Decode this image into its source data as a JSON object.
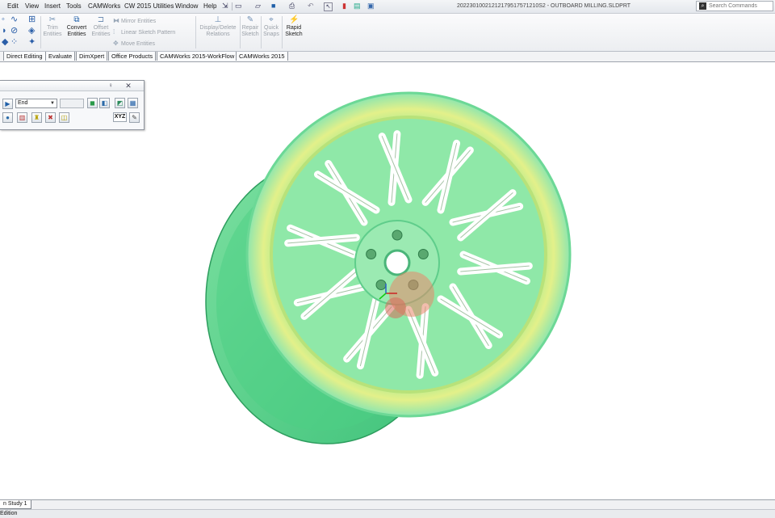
{
  "menu": {
    "items": [
      "Edit",
      "View",
      "Insert",
      "Tools",
      "CAMWorks",
      "CW 2015 Utilities",
      "Window",
      "Help"
    ]
  },
  "document": {
    "title": "20223010021212179517571210S2 - OUTBOARD MILLING.SLDPRT"
  },
  "search": {
    "placeholder": "Search Commands"
  },
  "ribbon": {
    "trim": "Trim Entities",
    "convert": "Convert Entities",
    "offset": "Offset Entities",
    "mirror": "Mirror Entities",
    "linear_pattern": "Linear Sketch Pattern",
    "move": "Move Entities",
    "relations": "Display/Delete Relations",
    "repair": "Repair Sketch",
    "quick_snaps": "Quick Snaps",
    "rapid_sketch": "Rapid Sketch"
  },
  "tabs": [
    "Direct Editing",
    "Evaluate",
    "DimXpert",
    "Office Products",
    "CAMWorks 2015-WorkFlow",
    "CAMWorks 2015"
  ],
  "panel": {
    "select_value": "End",
    "xyz_label": "XYZ"
  },
  "status": {
    "study_tab": "n Study 1",
    "text": "Edition"
  },
  "colors": {
    "model_green": "#7fe3a6",
    "model_yellow": "#d9ef8a",
    "accent_blue": "#1f5fa8"
  }
}
